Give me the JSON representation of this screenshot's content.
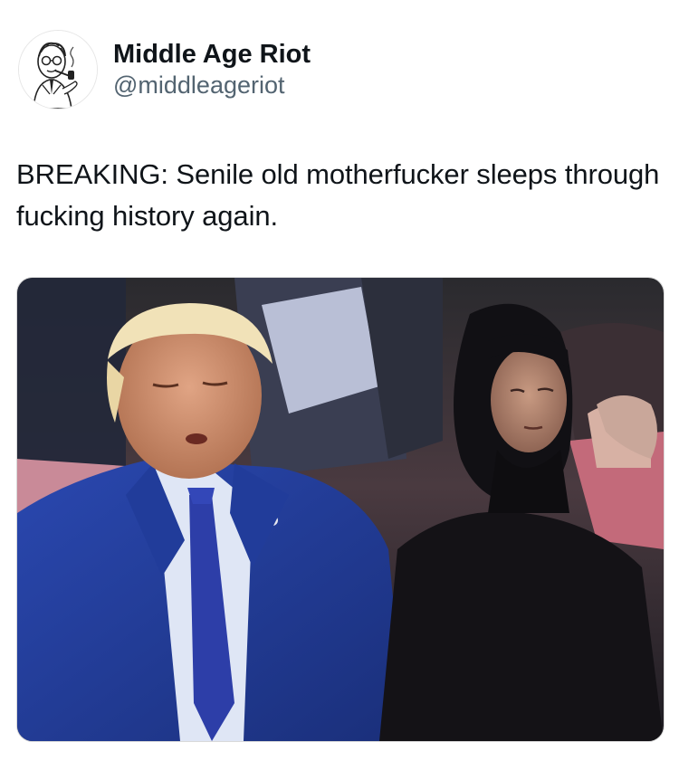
{
  "tweet": {
    "author": {
      "display_name": "Middle Age Riot",
      "handle": "@middleageriot",
      "avatar_icon": "cartoon-man-with-pipe-avatar"
    },
    "text": "BREAKING: Senile old motherfucker sleeps through fucking history again.",
    "media": {
      "type": "photo",
      "description_icon": "photo"
    }
  },
  "colors": {
    "text_primary": "#0f1419",
    "text_secondary": "#536471",
    "background": "#ffffff"
  }
}
